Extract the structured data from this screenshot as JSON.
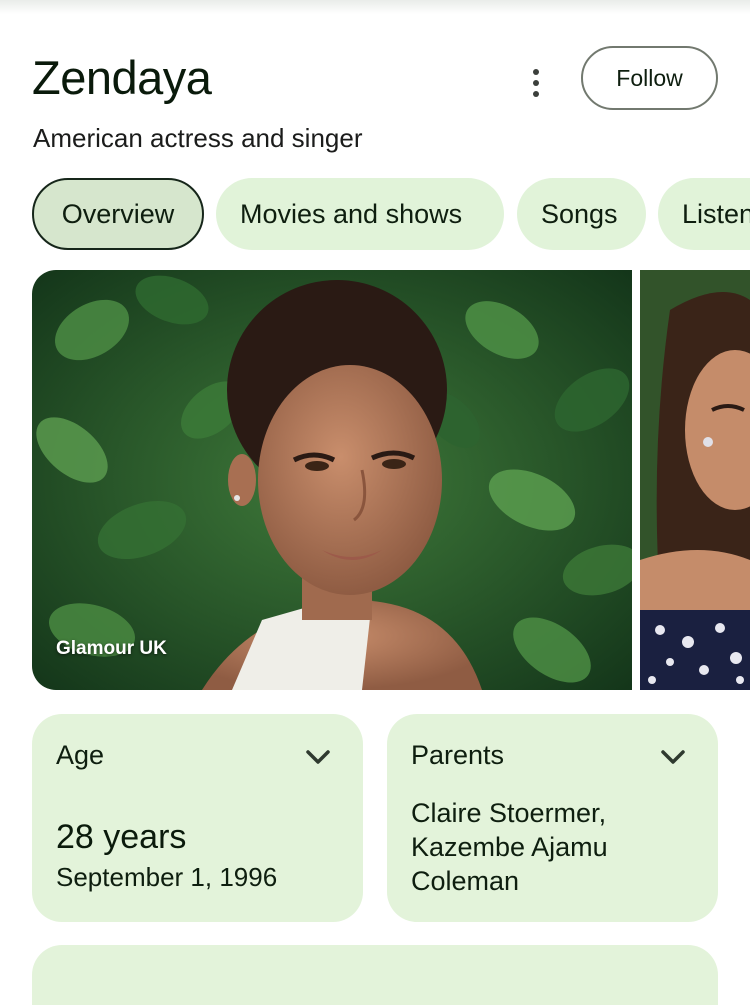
{
  "header": {
    "title": "Zendaya",
    "subtitle": "American actress and singer",
    "follow_label": "Follow"
  },
  "tabs": [
    {
      "label": "Overview",
      "active": true
    },
    {
      "label": "Movies and shows",
      "active": false
    },
    {
      "label": "Songs",
      "active": false
    },
    {
      "label": "Listen",
      "active": false
    }
  ],
  "images": [
    {
      "caption": "Glamour UK"
    },
    {
      "caption": ""
    }
  ],
  "cards": {
    "age": {
      "title": "Age",
      "value": "28 years",
      "detail": "September 1, 1996"
    },
    "parents": {
      "title": "Parents",
      "value": "Claire Stoermer, Kazembe Ajamu Coleman"
    }
  },
  "colors": {
    "chip_bg": "#e1f3d9",
    "chip_active_bg": "#d6e6cd",
    "card_bg": "#e3f3da",
    "text": "#0e1e0f"
  },
  "icons": [
    "more-vert-icon",
    "chevron-down-icon"
  ]
}
